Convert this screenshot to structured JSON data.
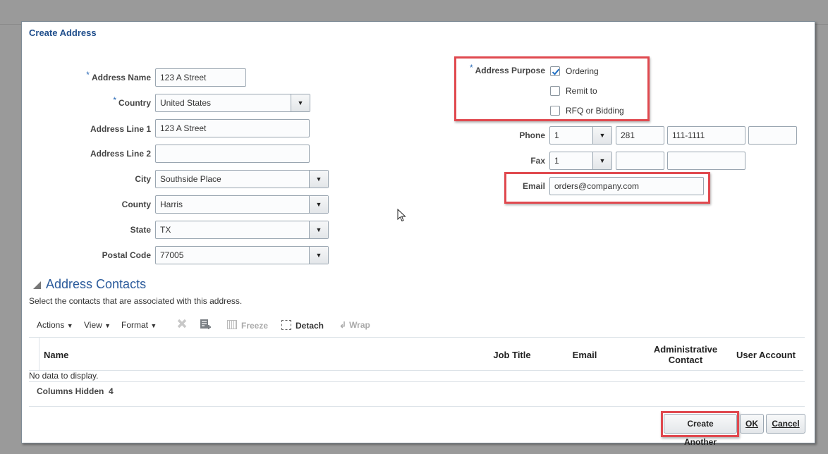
{
  "dialog": {
    "title": "Create Address"
  },
  "form": {
    "address_name": {
      "label": "Address Name",
      "required": "*",
      "value": "123 A Street"
    },
    "country": {
      "label": "Country",
      "required": "*",
      "value": "United States"
    },
    "address_line1": {
      "label": "Address Line 1",
      "value": "123 A Street"
    },
    "address_line2": {
      "label": "Address Line 2",
      "value": ""
    },
    "city": {
      "label": "City",
      "value": "Southside Place"
    },
    "county": {
      "label": "County",
      "value": "Harris"
    },
    "state": {
      "label": "State",
      "value": "TX"
    },
    "postal_code": {
      "label": "Postal Code",
      "value": "77005"
    },
    "address_purpose": {
      "label": "Address Purpose",
      "required": "*",
      "options": [
        {
          "label": "Ordering",
          "checked": true
        },
        {
          "label": "Remit to",
          "checked": false
        },
        {
          "label": "RFQ or Bidding",
          "checked": false
        }
      ]
    },
    "phone": {
      "label": "Phone",
      "country_code": "1",
      "area_code": "281",
      "number": "111-1111",
      "extension": ""
    },
    "fax": {
      "label": "Fax",
      "country_code": "1",
      "area_code": "",
      "number": ""
    },
    "email": {
      "label": "Email",
      "value": "orders@company.com"
    }
  },
  "contacts": {
    "title": "Address Contacts",
    "description": "Select the contacts that are associated with this address.",
    "toolbar": {
      "actions": "Actions",
      "view": "View",
      "format": "Format",
      "freeze": "Freeze",
      "detach": "Detach",
      "wrap": "Wrap"
    },
    "columns": [
      "Name",
      "Job Title",
      "Email",
      "Administrative Contact",
      "User Account"
    ],
    "admin_line1": "Administrative",
    "admin_line2": "Contact",
    "empty_text": "No data to display.",
    "columns_hidden_label": "Columns Hidden",
    "columns_hidden_count": "4"
  },
  "buttons": {
    "create_another": "Create Another",
    "ok": "OK",
    "cancel": "Cancel"
  },
  "highlight_color": "#e0494f",
  "accent_color": "#1f4e8c"
}
